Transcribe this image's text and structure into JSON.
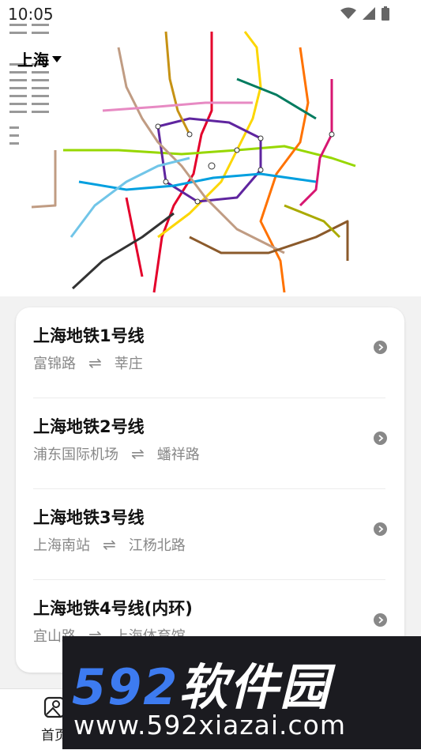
{
  "status_bar": {
    "time": "10:05"
  },
  "header": {
    "city": "上海"
  },
  "lines": [
    {
      "name": "上海地铁1号线",
      "from": "富锦路",
      "to": "莘庄"
    },
    {
      "name": "上海地铁2号线",
      "from": "浦东国际机场",
      "to": "蟠祥路"
    },
    {
      "name": "上海地铁3号线",
      "from": "上海南站",
      "to": "江杨北路"
    },
    {
      "name": "上海地铁4号线(内环)",
      "from": "宜山路",
      "to": "上海体育馆"
    }
  ],
  "route_swap_symbol": "⇌",
  "bottom_nav": {
    "home_label": "首页"
  },
  "watermark": {
    "brand_num": "592",
    "brand_cn": "软件园",
    "url": "www.592xiazai.com"
  },
  "colors": {
    "accent_blue": "#3d7bf0",
    "watermark_bg": "#1b1b20",
    "muted_text": "#888888"
  }
}
